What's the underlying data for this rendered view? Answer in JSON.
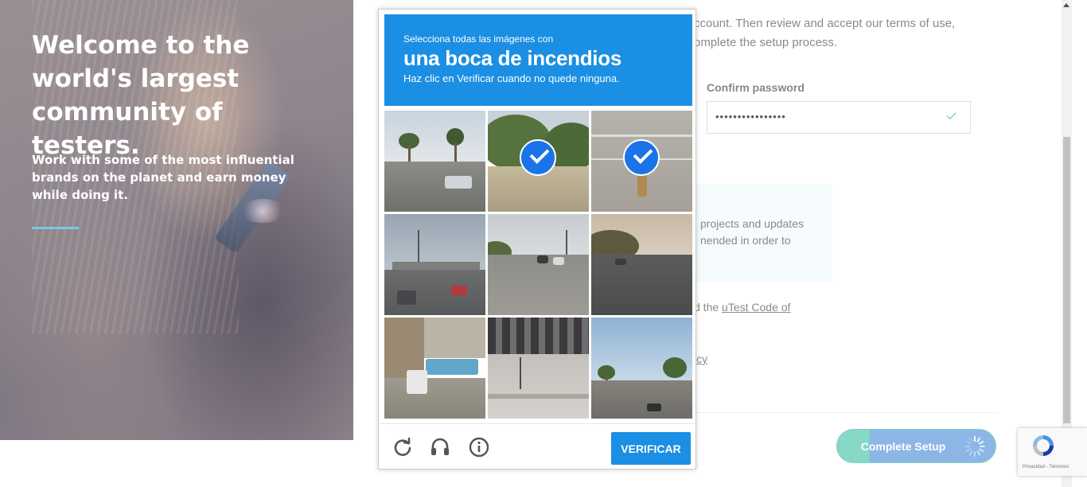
{
  "hero": {
    "title": "Welcome to the world's largest community of testers.",
    "subtitle": "Work with some of the most influential brands on the planet and earn money while doing it."
  },
  "form": {
    "intro_line1": "ccount. Then review and accept our terms of use,",
    "intro_line2": "omplete the setup process.",
    "confirm_password_label": "Confirm password",
    "confirm_password_value": "••••••••••••••••",
    "info_line1": "projects and updates",
    "info_line2": "nended in order to",
    "agree_prefix": "d the ",
    "code_link": "uTest Code of",
    "policy_link": "icy",
    "complete_button": "Complete Setup"
  },
  "captcha": {
    "instruction_top": "Selecciona todas las imágenes con",
    "object": "una boca de incendios",
    "instruction_bottom": "Haz clic en Verificar cuando no quede ninguna.",
    "verify_button": "VERIFICAR",
    "tiles": [
      {
        "selected": false
      },
      {
        "selected": true
      },
      {
        "selected": true
      },
      {
        "selected": false
      },
      {
        "selected": false
      },
      {
        "selected": false
      },
      {
        "selected": false
      },
      {
        "selected": false
      },
      {
        "selected": false
      }
    ],
    "icons": [
      "reload-icon",
      "audio-icon",
      "info-icon"
    ]
  },
  "recaptcha_badge": {
    "terms": "Privacidad - Términos"
  },
  "colors": {
    "captcha_blue": "#1a8fe3",
    "check_blue": "#1a73e8",
    "accent_teal": "#86d9c7",
    "hero_line": "#7ec8e3"
  }
}
